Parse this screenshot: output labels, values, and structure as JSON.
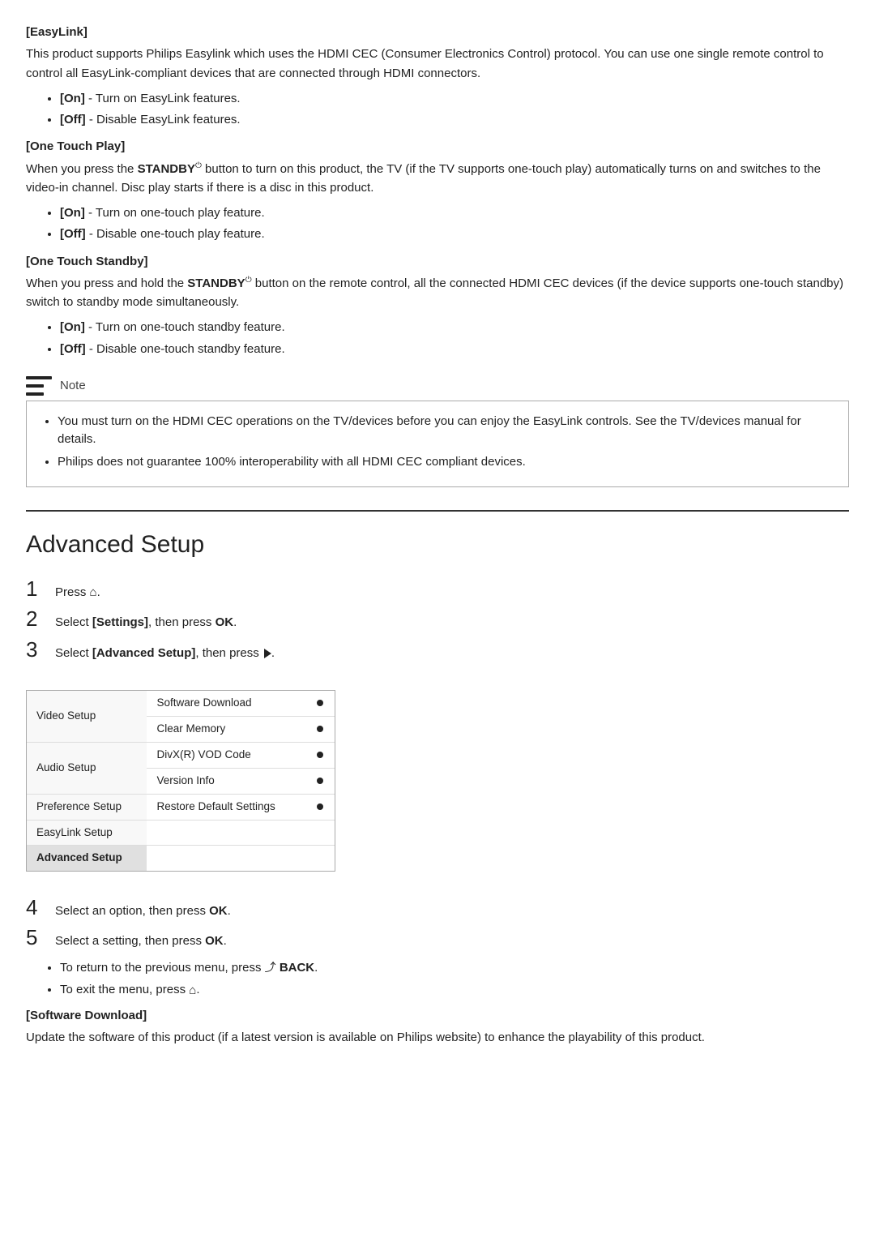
{
  "easylink": {
    "heading": "[EasyLink]",
    "description": "This product supports Philips Easylink which uses the HDMI CEC (Consumer Electronics Control) protocol. You can use one single remote control to control all EasyLink-compliant devices that are connected through HDMI connectors.",
    "bullets": [
      {
        "label": "[On]",
        "text": " - Turn on EasyLink features."
      },
      {
        "label": "[Off]",
        "text": " - Disable EasyLink features."
      }
    ]
  },
  "one_touch_play": {
    "heading": "[One Touch Play]",
    "description_pre": "When you press the ",
    "standby_label": "STANDBY",
    "description_post": " button to turn on this product, the TV (if the TV supports one-touch play) automatically turns on and switches to the video-in channel. Disc play starts if there is a disc in this product.",
    "bullets": [
      {
        "label": "[On]",
        "text": " - Turn on one-touch play feature."
      },
      {
        "label": "[Off]",
        "text": " - Disable one-touch play feature."
      }
    ]
  },
  "one_touch_standby": {
    "heading": "[One Touch Standby]",
    "description_pre": "When you press and hold the ",
    "standby_label": "STANDBY",
    "description_post": " button on the remote control, all the connected HDMI CEC devices (if the device supports one-touch standby) switch to standby mode simultaneously.",
    "bullets": [
      {
        "label": "[On]",
        "text": " - Turn on one-touch standby feature."
      },
      {
        "label": "[Off]",
        "text": " - Disable one-touch standby feature."
      }
    ]
  },
  "note": {
    "label": "Note",
    "items": [
      "You must turn on the HDMI CEC operations on the TV/devices before you can enjoy the EasyLink controls. See the TV/devices manual for details.",
      "Philips does not guarantee 100% interoperability with all HDMI CEC compliant devices."
    ]
  },
  "advanced_setup": {
    "heading": "Advanced Setup",
    "steps": [
      {
        "num": "1",
        "text": "Press ",
        "icon": "home"
      },
      {
        "num": "2",
        "text_pre": "Select ",
        "bold": "[Settings]",
        "text_post": ", then press ",
        "bold2": "OK",
        "text_end": "."
      },
      {
        "num": "3",
        "text_pre": "Select ",
        "bold": "[Advanced Setup]",
        "text_post": ", then press ",
        "arrow": true
      }
    ],
    "menu": {
      "left_items": [
        {
          "label": "Video Setup",
          "rowspan": 1
        },
        {
          "label": "Audio Setup",
          "rowspan": 1
        },
        {
          "label": "Preference Setup",
          "rowspan": 1
        },
        {
          "label": "EasyLink Setup",
          "rowspan": 1
        },
        {
          "label": "Advanced Setup",
          "rowspan": 1,
          "active": true
        }
      ],
      "right_items": [
        {
          "label": "Software Download",
          "dot": true
        },
        {
          "label": "Clear Memory",
          "dot": true
        },
        {
          "label": "DivX(R) VOD Code",
          "dot": true
        },
        {
          "label": "Version Info",
          "dot": true
        },
        {
          "label": "Restore Default Settings",
          "dot": true
        }
      ]
    },
    "steps_lower": [
      {
        "num": "4",
        "text_pre": "Select an option, then press ",
        "bold": "OK",
        "text_post": "."
      },
      {
        "num": "5",
        "text_pre": "Select a setting, then press ",
        "bold": "OK",
        "text_post": "."
      }
    ],
    "sub_bullets": [
      {
        "text_pre": "To return to the previous menu, press ",
        "icon": "back",
        "bold": " BACK",
        "text_post": "."
      },
      {
        "text_pre": "To exit the menu, press ",
        "icon": "home",
        "text_post": "."
      }
    ],
    "software_download": {
      "heading": "[Software Download]",
      "description": "Update the software of this product (if a latest version is available on Philips website) to enhance the playability of this product."
    }
  }
}
